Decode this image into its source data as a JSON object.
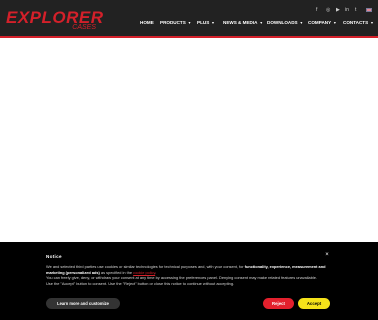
{
  "header": {
    "logo": {
      "main": "EXPLORER",
      "sub": "CASES"
    },
    "social_icons": [
      "facebook-icon",
      "instagram-icon",
      "youtube-icon",
      "linkedin-icon",
      "twitter-icon"
    ],
    "language_flag": "en-flag",
    "nav": [
      {
        "label": "HOME",
        "has_dropdown": false
      },
      {
        "label": "PRODUCTS",
        "has_dropdown": true
      },
      {
        "label": "PLUS",
        "has_dropdown": true
      },
      {
        "label": "NEWS & MEDIA",
        "has_dropdown": true
      },
      {
        "label": "DOWNLOADS",
        "has_dropdown": true
      },
      {
        "label": "COMPANY",
        "has_dropdown": true
      },
      {
        "label": "CONTACTS",
        "has_dropdown": true
      }
    ],
    "caret": "▼"
  },
  "cookie": {
    "title": "Notice",
    "close": "×",
    "p1_a": "We and selected third parties use cookies or similar technologies for technical purposes and, with your consent, for ",
    "p1_b": "functionality, experience, measurement and marketing (personalized ads)",
    "p1_c": " as specified in the ",
    "p1_link": "cookie policy",
    "p1_d": ".",
    "p2": "You can freely give, deny, or withdraw your consent at any time by accessing the preferences panel. Denying consent may make related features unavailable.",
    "p3": "Use the \"Accept\" button to consent. Use the \"Reject\" button or close this notice to continue without accepting.",
    "learn_more": "Learn more and customize",
    "reject": "Reject",
    "accept": "Accept"
  },
  "colors": {
    "brand_red": "#d4202a",
    "header_bg": "#222222",
    "accept_yellow": "#f5e21a",
    "reject_red": "#e3202d"
  }
}
